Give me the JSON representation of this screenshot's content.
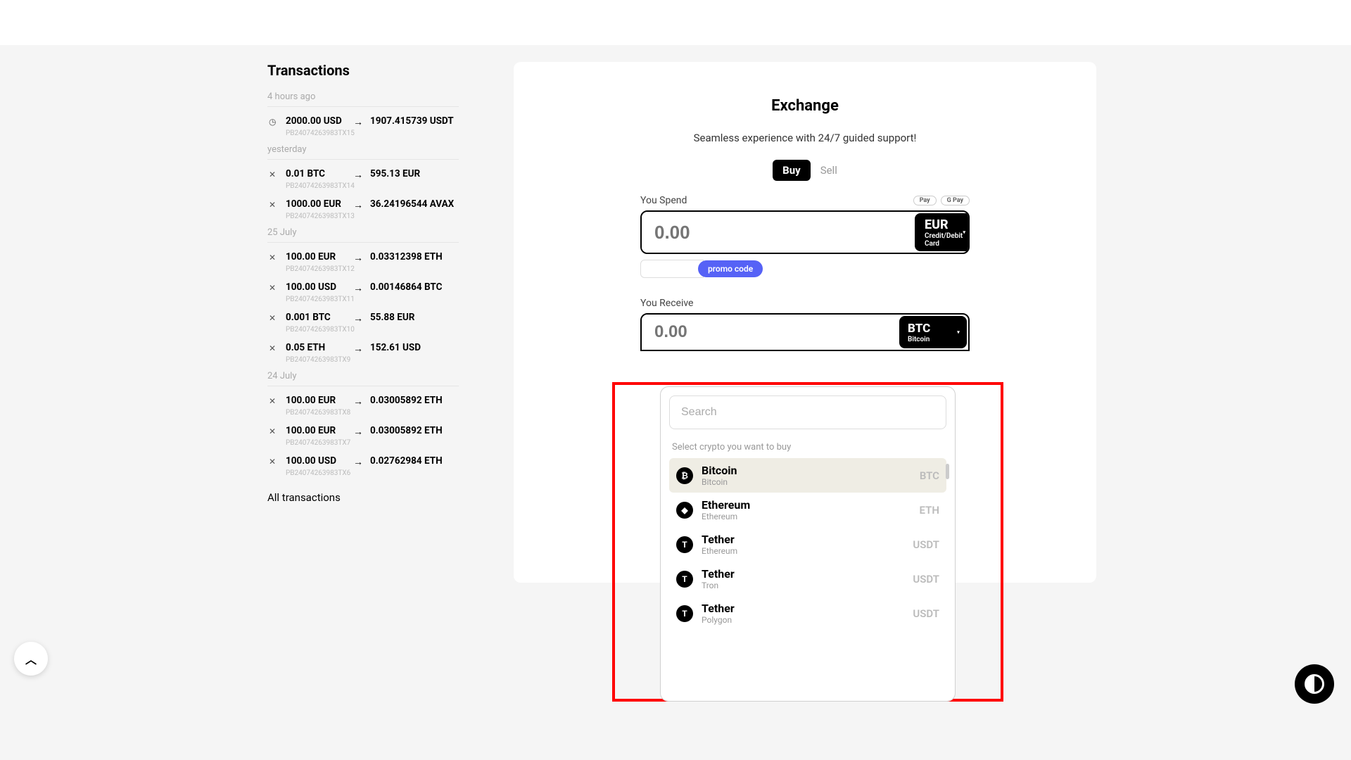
{
  "sidebar": {
    "title": "Transactions",
    "groups": [
      {
        "label": "4 hours ago",
        "items": [
          {
            "icon": "◷",
            "from": "2000.00 USD",
            "to": "1907.415739 USDT",
            "id": "PB24074263983TX15"
          }
        ]
      },
      {
        "label": "yesterday",
        "items": [
          {
            "icon": "✕",
            "from": "0.01 BTC",
            "to": "595.13 EUR",
            "id": "PB24074263983TX14"
          },
          {
            "icon": "✕",
            "from": "1000.00 EUR",
            "to": "36.24196544 AVAX",
            "id": "PB24074263983TX13"
          }
        ]
      },
      {
        "label": "25 July",
        "items": [
          {
            "icon": "✕",
            "from": "100.00 EUR",
            "to": "0.03312398 ETH",
            "id": "PB24074263983TX12"
          },
          {
            "icon": "✕",
            "from": "100.00 USD",
            "to": "0.00146864 BTC",
            "id": "PB24074263983TX11"
          },
          {
            "icon": "✕",
            "from": "0.001 BTC",
            "to": "55.88 EUR",
            "id": "PB24074263983TX10"
          },
          {
            "icon": "✕",
            "from": "0.05 ETH",
            "to": "152.61 USD",
            "id": "PB24074263983TX9"
          }
        ]
      },
      {
        "label": "24 July",
        "items": [
          {
            "icon": "✕",
            "from": "100.00 EUR",
            "to": "0.03005892 ETH",
            "id": "PB24074263983TX8"
          },
          {
            "icon": "✕",
            "from": "100.00 EUR",
            "to": "0.03005892 ETH",
            "id": "PB24074263983TX7"
          },
          {
            "icon": "✕",
            "from": "100.00 USD",
            "to": "0.02762984 ETH",
            "id": "PB24074263983TX6"
          }
        ]
      }
    ],
    "all_link": "All transactions"
  },
  "exchange": {
    "title": "Exchange",
    "subtitle": "Seamless experience with 24/7 guided support!",
    "tabs": {
      "buy": "Buy",
      "sell": "Sell"
    },
    "spend": {
      "label": "You Spend",
      "placeholder": "0.00",
      "currency_code": "EUR",
      "currency_sub": "Credit/Debit Card",
      "pay_badges": [
        "Pay",
        "G Pay"
      ]
    },
    "promo": {
      "label": "promo code"
    },
    "receive": {
      "label": "You Receive",
      "placeholder": "0.00",
      "currency_code": "BTC",
      "currency_sub": "Bitcoin"
    }
  },
  "dropdown": {
    "search_placeholder": "Search",
    "hint": "Select crypto you want to buy",
    "items": [
      {
        "name": "Bitcoin",
        "net": "Bitcoin",
        "sym": "BTC",
        "glyph": "₿",
        "selected": true
      },
      {
        "name": "Ethereum",
        "net": "Ethereum",
        "sym": "ETH",
        "glyph": "◆",
        "selected": false
      },
      {
        "name": "Tether",
        "net": "Ethereum",
        "sym": "USDT",
        "glyph": "T",
        "selected": false
      },
      {
        "name": "Tether",
        "net": "Tron",
        "sym": "USDT",
        "glyph": "T",
        "selected": false
      },
      {
        "name": "Tether",
        "net": "Polygon",
        "sym": "USDT",
        "glyph": "T",
        "selected": false
      }
    ]
  }
}
